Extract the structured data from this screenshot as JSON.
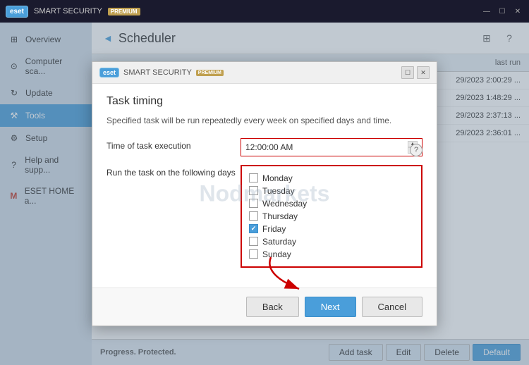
{
  "titleBar": {
    "logoText": "eset",
    "appName": "SMART SECURITY",
    "premiumBadge": "PREMIUM",
    "controls": [
      "—",
      "☐",
      "✕"
    ]
  },
  "sidebar": {
    "items": [
      {
        "id": "overview",
        "label": "Overview",
        "icon": "⊞"
      },
      {
        "id": "computer-scan",
        "label": "Computer sca...",
        "icon": "🔍"
      },
      {
        "id": "update",
        "label": "Update",
        "icon": "↻"
      },
      {
        "id": "tools",
        "label": "Tools",
        "icon": "🔧",
        "active": true
      },
      {
        "id": "setup",
        "label": "Setup",
        "icon": "⚙"
      },
      {
        "id": "help",
        "label": "Help and supp...",
        "icon": "?"
      },
      {
        "id": "eset-home",
        "label": "ESET HOME a...",
        "icon": "M"
      }
    ]
  },
  "pageHeader": {
    "backArrow": "◄",
    "title": "Scheduler",
    "icons": [
      "⊞",
      "?"
    ]
  },
  "table": {
    "columns": [
      "last run"
    ],
    "rows": [
      {
        "lastRun": "29/2023 2:00:29 ..."
      },
      {
        "lastRun": "29/2023 1:48:29 ..."
      },
      {
        "lastRun": "29/2023 2:37:13 ..."
      },
      {
        "lastRun": "29/2023 2:36:01 ..."
      }
    ]
  },
  "bottomBar": {
    "statusText": "Progress. Protected.",
    "buttons": [
      {
        "id": "add-task",
        "label": "Add task"
      },
      {
        "id": "edit",
        "label": "Edit"
      },
      {
        "id": "delete",
        "label": "Delete"
      },
      {
        "id": "default",
        "label": "Default"
      }
    ]
  },
  "modal": {
    "titleBar": {
      "logoText": "eset",
      "appName": "SMART SECURITY",
      "premiumBadge": "PREMIUM"
    },
    "title": "Task timing",
    "description": "Specified task will be run repeatedly every week on specified days and time.",
    "helpIcon": "?",
    "form": {
      "timeLabel": "Time of task execution",
      "timeValue": "12:00:00 AM",
      "daysLabel": "Run the task on the following days",
      "days": [
        {
          "id": "monday",
          "label": "Monday",
          "checked": false
        },
        {
          "id": "tuesday",
          "label": "Tuesday",
          "checked": false
        },
        {
          "id": "wednesday",
          "label": "Wednesday",
          "checked": false
        },
        {
          "id": "thursday",
          "label": "Thursday",
          "checked": false
        },
        {
          "id": "friday",
          "label": "Friday",
          "checked": true
        },
        {
          "id": "saturday",
          "label": "Saturday",
          "checked": false
        },
        {
          "id": "sunday",
          "label": "Sunday",
          "checked": false
        }
      ]
    },
    "buttons": {
      "back": "Back",
      "next": "Next",
      "cancel": "Cancel"
    }
  },
  "watermark": "Nodmarkets"
}
